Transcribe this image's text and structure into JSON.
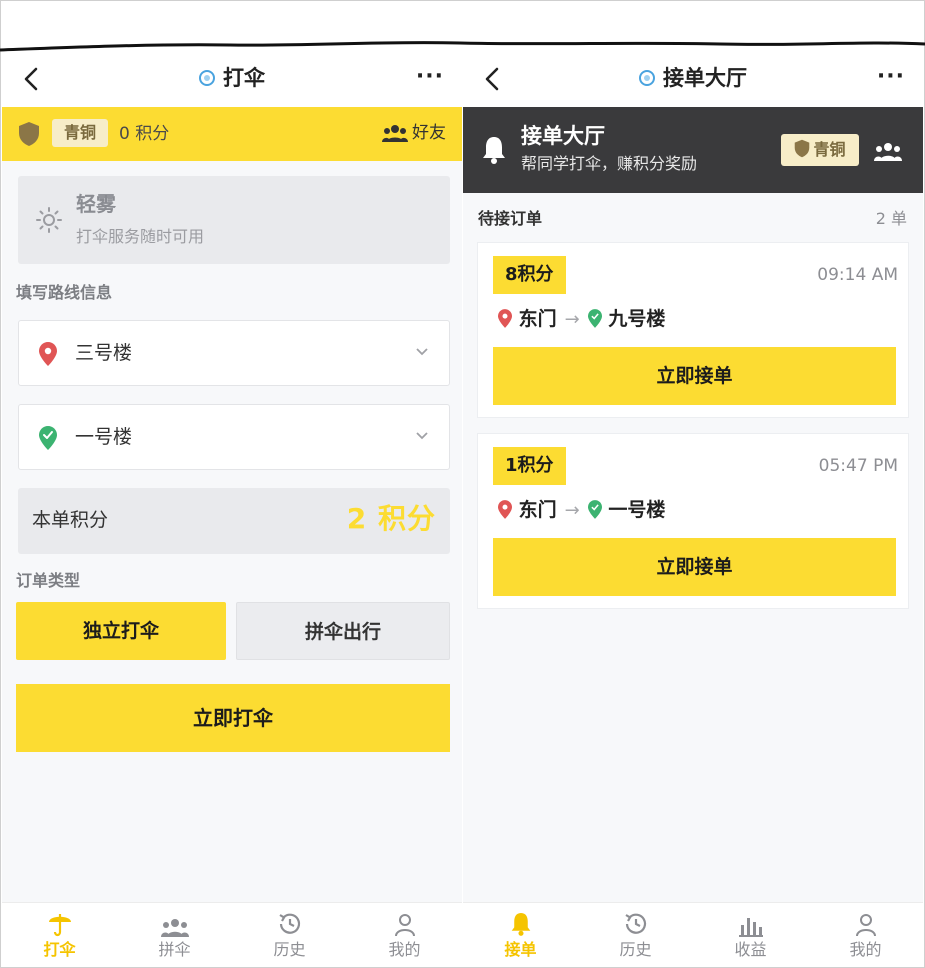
{
  "colors": {
    "accent_yellow": "#fcdc32",
    "dark_header": "#3a3a3c",
    "bronze": "#8b7647",
    "pin_red": "#e05555",
    "pin_green": "#3cb371"
  },
  "left": {
    "header": {
      "title": "打伞",
      "more": "···"
    },
    "rank": {
      "badge": "青铜",
      "points": "0 积分",
      "friends": "好友"
    },
    "weather": {
      "icon": "sun-icon",
      "name": "轻雾",
      "desc": "打伞服务随时可用"
    },
    "route_label": "填写路线信息",
    "from": {
      "value": "三号楼",
      "icon": "map-pin-icon"
    },
    "to": {
      "value": "一号楼",
      "icon": "shield-check-pin-icon"
    },
    "order_points": {
      "label": "本单积分",
      "value": "2 积分"
    },
    "order_type_label": "订单类型",
    "order_types": [
      {
        "label": "独立打伞",
        "selected": true
      },
      {
        "label": "拼伞出行",
        "selected": false
      }
    ],
    "submit": "立即打伞",
    "tabs": [
      {
        "label": "打伞",
        "icon": "umbrella-icon",
        "active": true
      },
      {
        "label": "拼伞",
        "icon": "group-icon",
        "active": false
      },
      {
        "label": "历史",
        "icon": "history-icon",
        "active": false
      },
      {
        "label": "我的",
        "icon": "user-icon",
        "active": false
      }
    ]
  },
  "right": {
    "header": {
      "title": "接单大厅",
      "more": "···"
    },
    "hall": {
      "title": "接单大厅",
      "subtitle": "帮同学打伞，赚积分奖励",
      "badge": "青铜"
    },
    "pending_label": "待接订单",
    "count": "2 单",
    "orders": [
      {
        "points": "8积分",
        "time": "09:14 AM",
        "from": "东门",
        "to": "九号楼",
        "accept": "立即接单"
      },
      {
        "points": "1积分",
        "time": "05:47 PM",
        "from": "东门",
        "to": "一号楼",
        "accept": "立即接单"
      }
    ],
    "tabs": [
      {
        "label": "接单",
        "icon": "bell-icon",
        "active": true
      },
      {
        "label": "历史",
        "icon": "history-icon",
        "active": false
      },
      {
        "label": "收益",
        "icon": "bar-chart-icon",
        "active": false
      },
      {
        "label": "我的",
        "icon": "user-icon",
        "active": false
      }
    ]
  }
}
